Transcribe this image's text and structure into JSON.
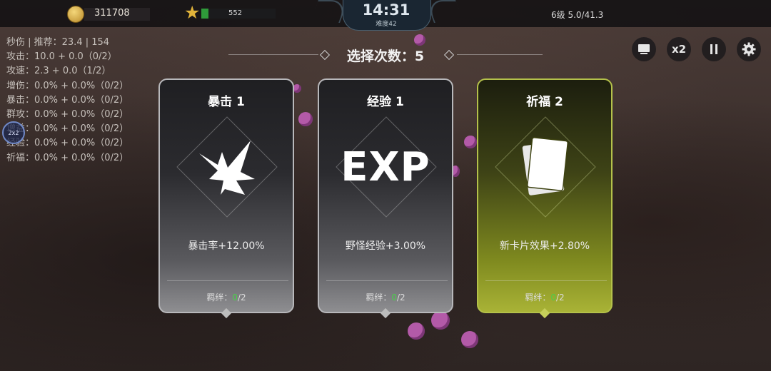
{
  "top_bar": {
    "gold": "311708",
    "xp_value": "552",
    "xp_progress": 0.1,
    "time": "14:31",
    "difficulty": "难度42",
    "level_info": "6级 5.0/41.3"
  },
  "stats": [
    "秒伤 | 推荐：23.4 | 154",
    "攻击：10.0 + 0.0（0/2）",
    "攻速：2.3 + 0.0（1/2）",
    "增伤：0.0% + 0.0%（0/2）",
    "暴击：0.0% + 0.0%（0/2）",
    "群攻：0.0% + 0.0%（0/2）",
    "增益：0.0% + 0.0%（0/2）",
    "经验：0.0% + 0.0%（0/2）",
    "祈福：0.0% + 0.0%（0/2）"
  ],
  "side_icon_text": "2x2",
  "controls": {
    "speed_label": "x2"
  },
  "header": {
    "choose_text": "选择次数：5"
  },
  "cards": [
    {
      "title": "暴击 1",
      "icon": "burst-icon",
      "desc": "暴击率+12.00%",
      "foot_label": "羁绊：",
      "foot_count": "0",
      "foot_total": "/2"
    },
    {
      "title": "经验 1",
      "icon": "exp-icon",
      "icon_text": "EXP",
      "desc": "野怪经验+3.00%",
      "foot_label": "羁绊：",
      "foot_count": "0",
      "foot_total": "/2"
    },
    {
      "title": "祈福 2",
      "icon": "card-stack-icon",
      "desc": "新卡片效果+2.80%",
      "foot_label": "羁绊：",
      "foot_count": "0",
      "foot_total": "/2"
    }
  ],
  "colors": {
    "gray_border": "#b8b8bb",
    "gold_border": "#b4c14a",
    "bond_green": "#4ad04a",
    "xp_green": "#2f9a3a"
  }
}
